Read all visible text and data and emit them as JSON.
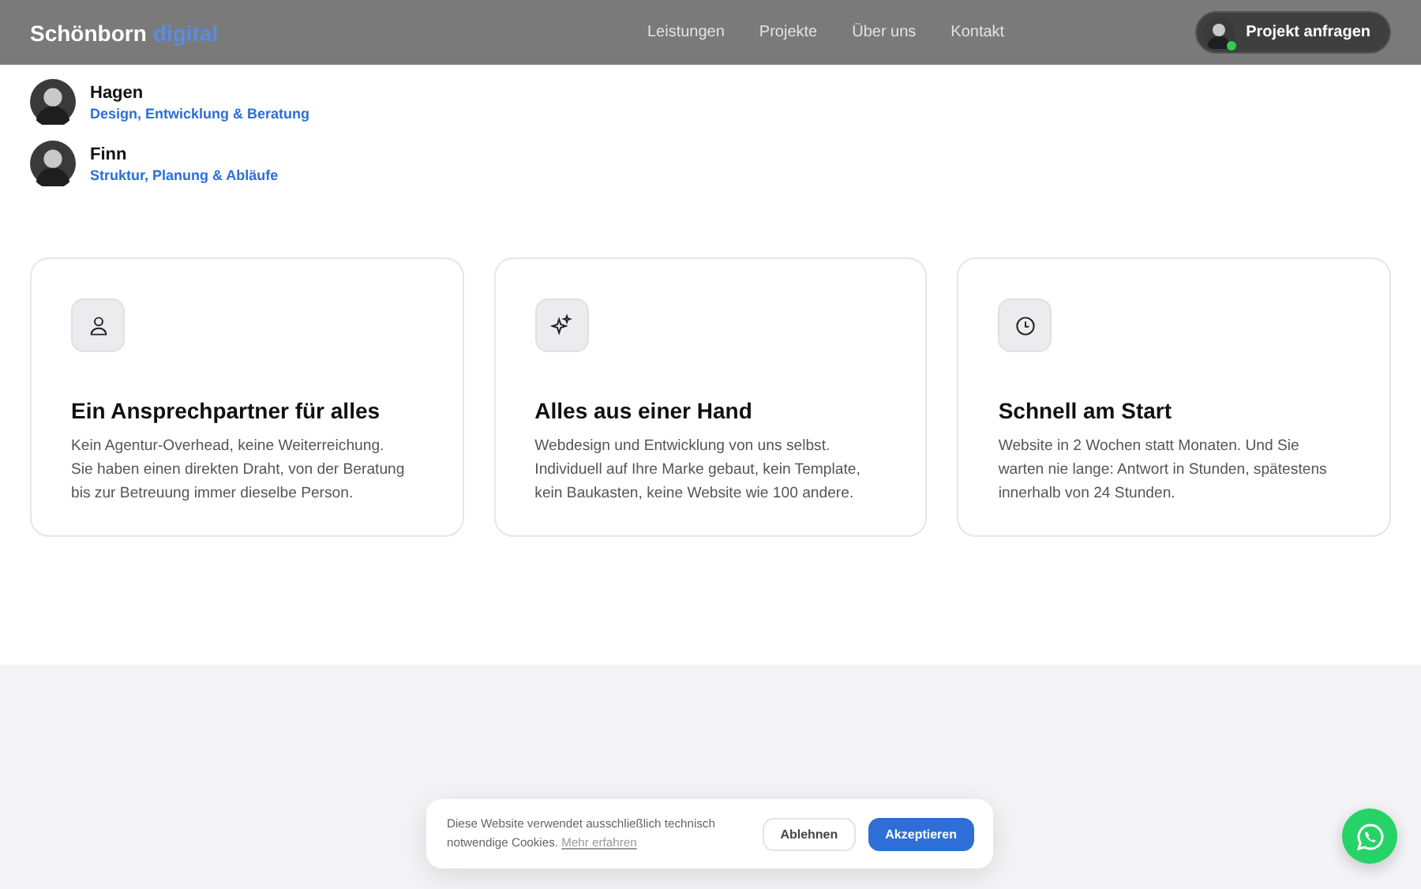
{
  "header": {
    "logo": {
      "name": "Schönborn",
      "accent": "digital"
    },
    "nav": [
      "Leistungen",
      "Projekte",
      "Über uns",
      "Kontakt"
    ],
    "cta": {
      "label": "Projekt anfragen",
      "online": true
    }
  },
  "team": [
    {
      "name": "Hagen",
      "role": "Design, Entwicklung & Beratung"
    },
    {
      "name": "Finn",
      "role": "Struktur, Planung & Abläufe"
    }
  ],
  "features": [
    {
      "kind": "person",
      "title": "Ein Ansprechpartner für alles",
      "text": "Kein Agentur-Overhead, keine Weiterreichung. Sie haben einen direkten Draht, von der Beratung bis zur Betreuung immer dieselbe Person."
    },
    {
      "kind": "sparkles",
      "title": "Alles aus einer Hand",
      "text": "Webdesign und Entwicklung von uns selbst. Individuell auf Ihre Marke gebaut, kein Template, kein Baukasten, keine Website wie 100 andere."
    },
    {
      "kind": "clock",
      "title": "Schnell am Start",
      "text": "Website in 2 Wochen statt Monaten. Und Sie warten nie lange: Antwort in Stunden, spätestens innerhalb von 24 Stunden."
    }
  ],
  "cookie_banner": {
    "text": "Diese Website verwendet ausschließlich technisch notwendige Cookies.",
    "link": "Mehr erfahren",
    "buttons": [
      {
        "label": "Ablehnen",
        "kind": "secondary"
      },
      {
        "label": "Akzeptieren",
        "kind": "primary"
      }
    ]
  }
}
